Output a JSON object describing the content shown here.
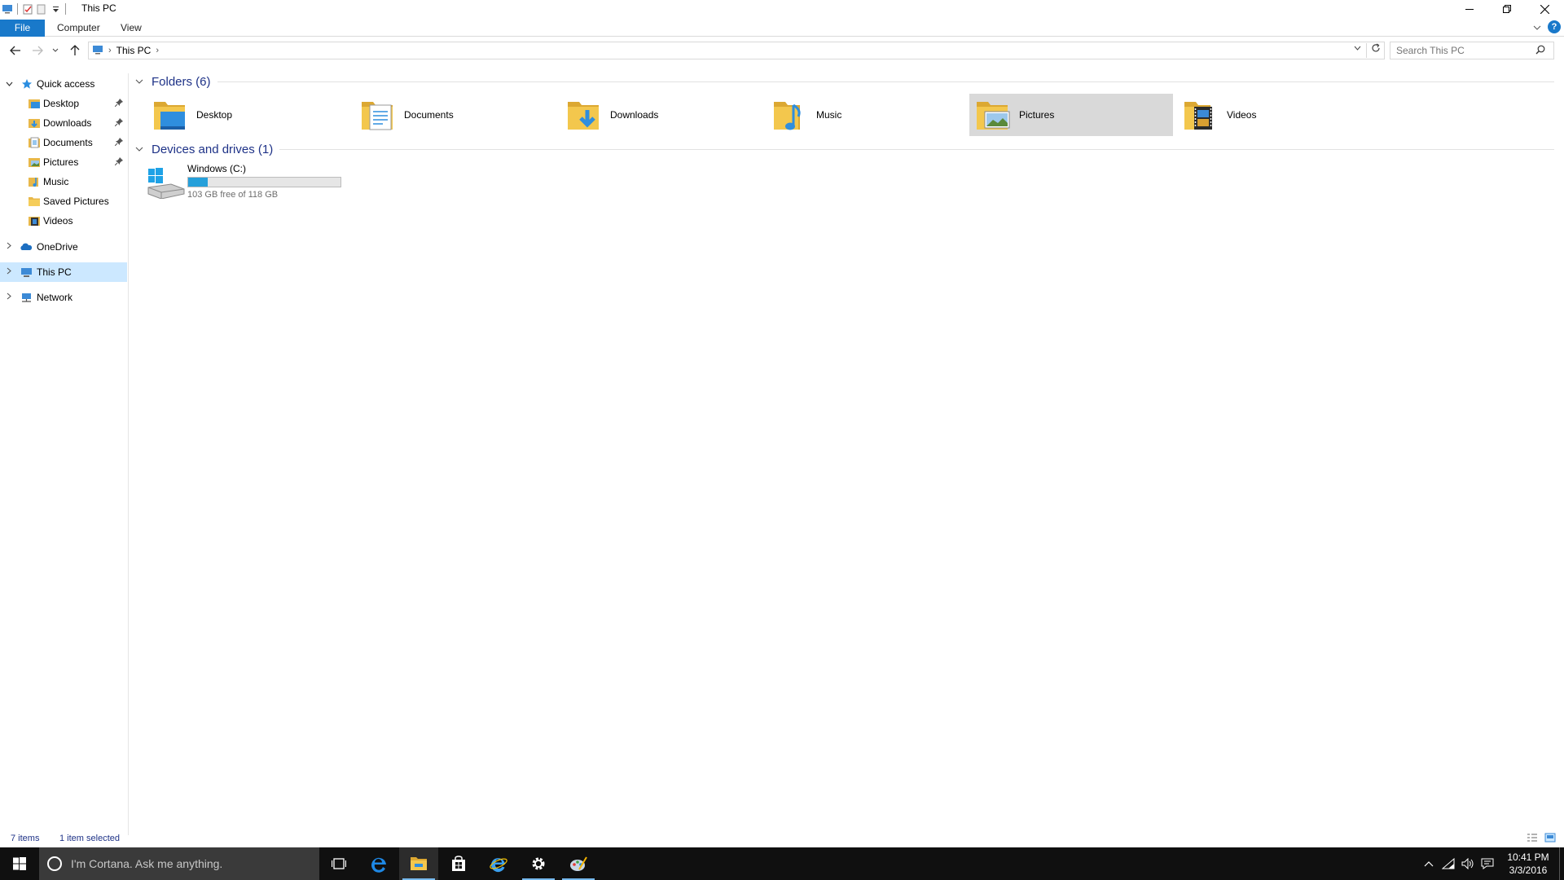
{
  "window": {
    "title": "This PC"
  },
  "ribbon": {
    "tabs": [
      "File",
      "Computer",
      "View"
    ]
  },
  "address": {
    "crumbs": [
      "This PC"
    ],
    "search_placeholder": "Search This PC"
  },
  "nav": {
    "quick_access": "Quick access",
    "quick_items": [
      "Desktop",
      "Downloads",
      "Documents",
      "Pictures",
      "Music",
      "Saved Pictures",
      "Videos"
    ],
    "onedrive": "OneDrive",
    "this_pc": "This PC",
    "network": "Network"
  },
  "content": {
    "folders_header": "Folders (6)",
    "folders": [
      "Desktop",
      "Documents",
      "Downloads",
      "Music",
      "Pictures",
      "Videos"
    ],
    "selected_folder": "Pictures",
    "drives_header": "Devices and drives (1)",
    "drive": {
      "name": "Windows (C:)",
      "free_text": "103 GB free of 118 GB",
      "used_fraction": 0.127
    }
  },
  "status": {
    "items": "7 items",
    "selection": "1 item selected"
  },
  "taskbar": {
    "cortana_placeholder": "I'm Cortana. Ask me anything.",
    "time": "10:41 PM",
    "date": "3/3/2016"
  },
  "colors": {
    "accent": "#1979ca",
    "selection": "#cce8ff",
    "taskbar": "#101010",
    "drive_fill": "#26a0da"
  }
}
